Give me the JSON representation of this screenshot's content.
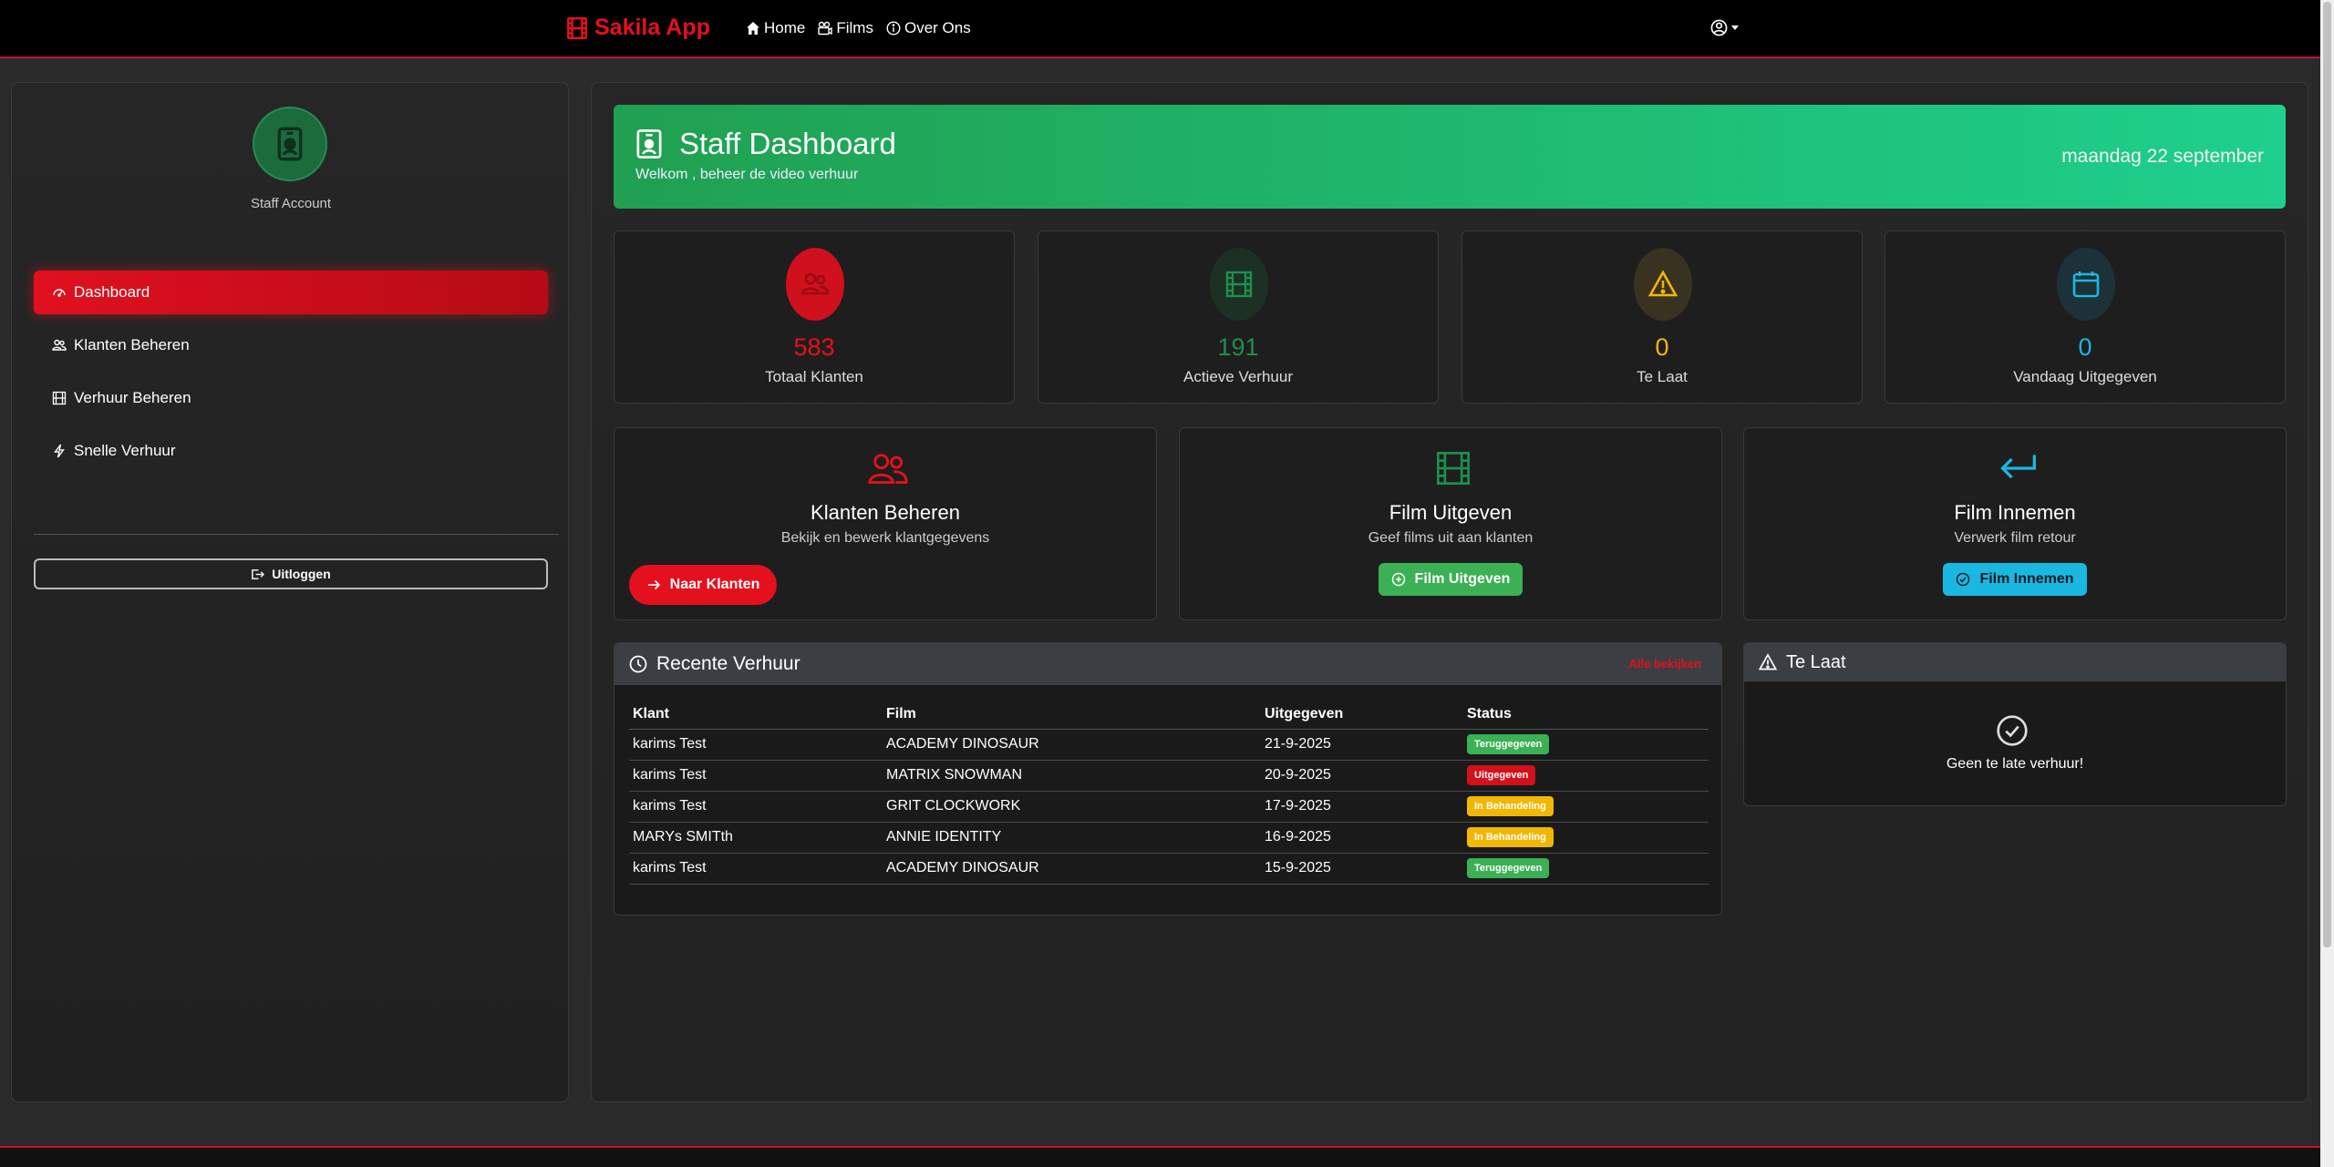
{
  "nav": {
    "brand": "Sakila App",
    "links": [
      {
        "label": "Home",
        "icon": "house-icon"
      },
      {
        "label": "Films",
        "icon": "camera-reels-icon"
      },
      {
        "label": "Over Ons",
        "icon": "info-circle-icon"
      }
    ],
    "user_icon": "person-circle-icon"
  },
  "sidebar": {
    "account_label": "Staff Account",
    "items": [
      {
        "label": "Dashboard",
        "icon": "speedometer-icon",
        "active": true
      },
      {
        "label": "Klanten Beheren",
        "icon": "people-icon"
      },
      {
        "label": "Verhuur Beheren",
        "icon": "film-icon"
      },
      {
        "label": "Snelle Verhuur",
        "icon": "lightning-icon"
      }
    ],
    "logout_label": "Uitloggen"
  },
  "hero": {
    "title": "Staff Dashboard",
    "subtitle": "Welkom , beheer de video verhuur",
    "date": "maandag 22 september"
  },
  "stats": [
    {
      "value": "583",
      "label": "Totaal Klanten",
      "color": "#e5101d",
      "icon": "people-icon"
    },
    {
      "value": "191",
      "label": "Actieve Verhuur",
      "color": "#1f8f4e",
      "icon": "film-icon"
    },
    {
      "value": "0",
      "label": "Te Laat",
      "color": "#f2b705",
      "icon": "warning-triangle-icon"
    },
    {
      "value": "0",
      "label": "Vandaag Uitgegeven",
      "color": "#1ab8e0",
      "icon": "calendar-icon"
    }
  ],
  "actions": [
    {
      "title": "Klanten Beheren",
      "desc": "Bekijk en bewerk klantgegevens",
      "button": "Naar Klanten",
      "color": "#e5101d"
    },
    {
      "title": "Film Uitgeven",
      "desc": "Geef films uit aan klanten",
      "button": "Film Uitgeven",
      "color": "#3cb054"
    },
    {
      "title": "Film Innemen",
      "desc": "Verwerk film retour",
      "button": "Film Innemen",
      "color": "#1ab8e0"
    }
  ],
  "recent": {
    "title": "Recente Verhuur",
    "view_all": "Alle bekijken",
    "columns": [
      "Klant",
      "Film",
      "Uitgegeven",
      "Status"
    ],
    "rows": [
      {
        "klant": "karims Test",
        "film": "ACADEMY DINOSAUR",
        "uitgegeven": "21-9-2025",
        "status": "Teruggegeven"
      },
      {
        "klant": "karims Test",
        "film": "MATRIX SNOWMAN",
        "uitgegeven": "20-9-2025",
        "status": "Uitgegeven"
      },
      {
        "klant": "karims Test",
        "film": "GRIT CLOCKWORK",
        "uitgegeven": "17-9-2025",
        "status": "In Behandeling"
      },
      {
        "klant": "MARYs SMITth",
        "film": "ANNIE IDENTITY",
        "uitgegeven": "16-9-2025",
        "status": "In Behandeling"
      },
      {
        "klant": "karims Test",
        "film": "ACADEMY DINOSAUR",
        "uitgegeven": "15-9-2025",
        "status": "Teruggegeven"
      }
    ],
    "status_colors": {
      "Teruggegeven": "#3cb054",
      "Uitgegeven": "#d4101d",
      "In Behandeling": "#f2b705"
    }
  },
  "late": {
    "title": "Te Laat",
    "empty_text": "Geen te late verhuur!"
  }
}
